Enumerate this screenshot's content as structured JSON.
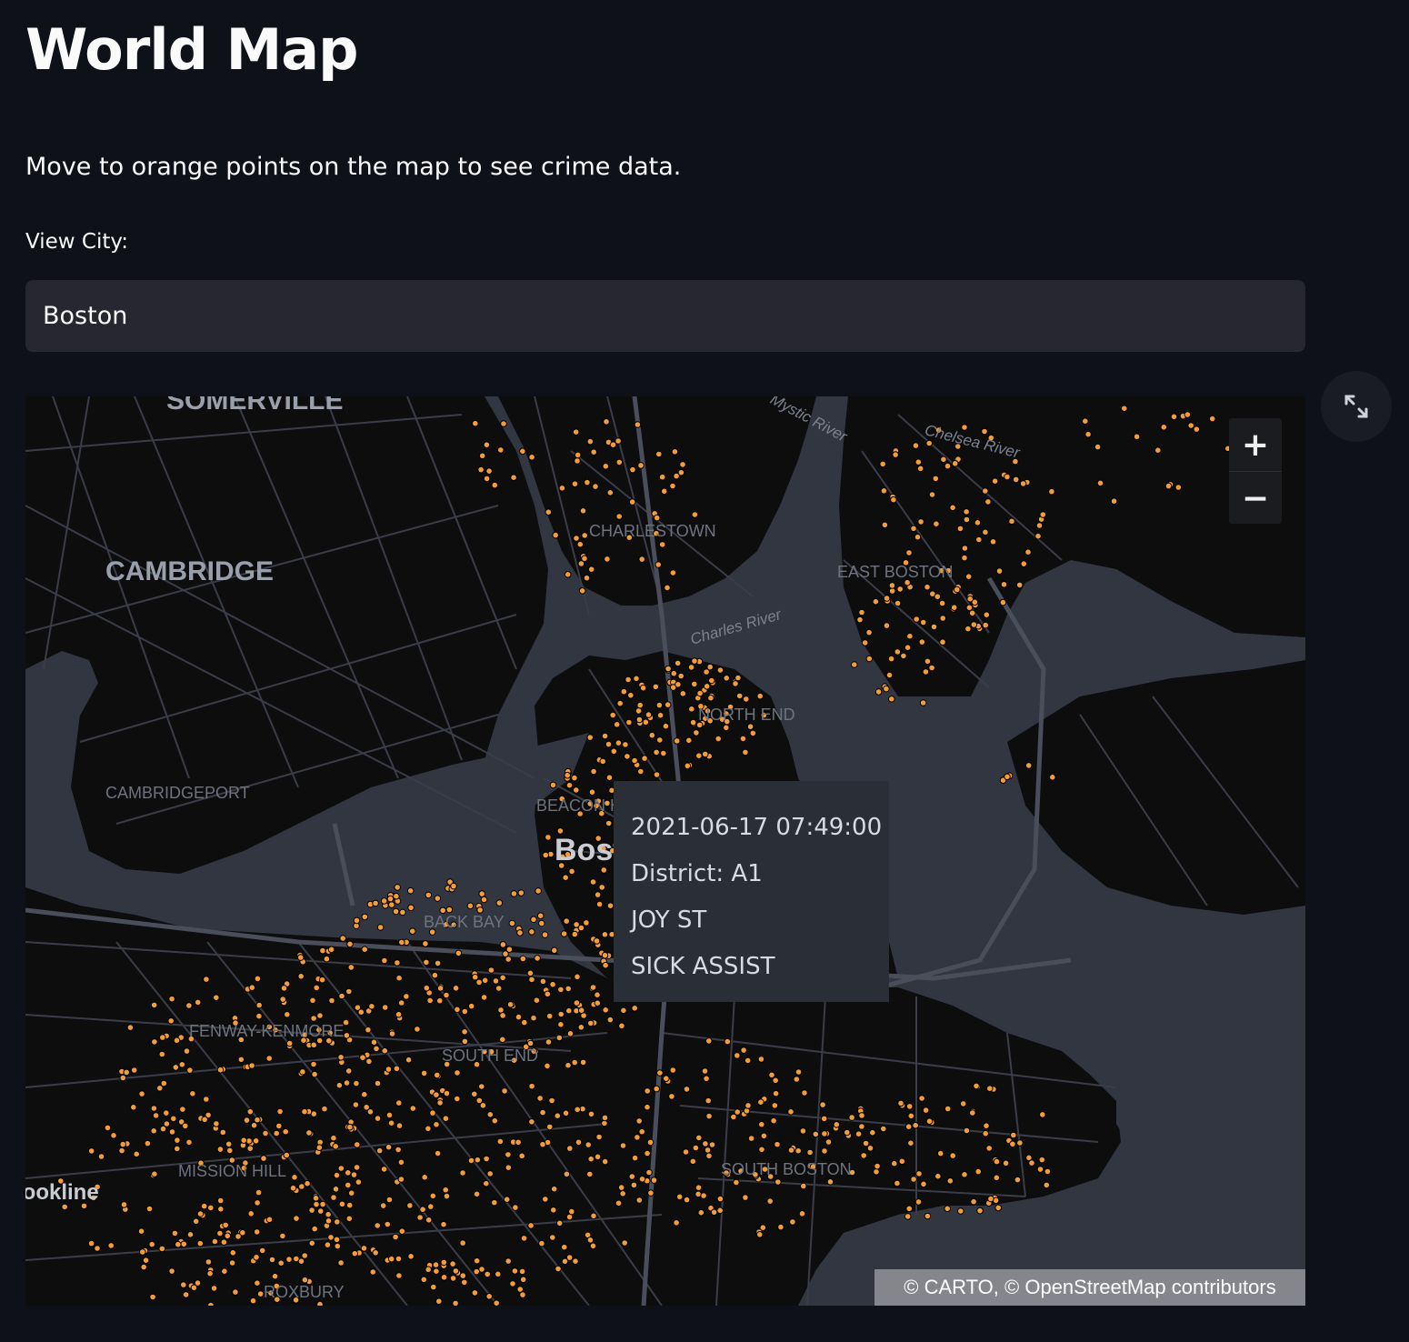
{
  "title": "World Map",
  "subtitle": "Move to orange points on the map to see crime data.",
  "city_select": {
    "label": "View City:",
    "value": "Boston"
  },
  "map": {
    "marker_color": "#f39c3a",
    "water_color": "#323640",
    "land_color": "#0d0d0e",
    "road_color": "#3a3d48",
    "icons": [
      "fullscreen-icon",
      "plus-icon",
      "minus-icon"
    ],
    "zoom_in_label": "+",
    "zoom_out_label": "−",
    "places": {
      "somerville": "SOMERVILLE",
      "cambridge": "CAMBRIDGE",
      "cambridgeport": "CAMBRIDGEPORT",
      "charlestown": "CHARLESTOWN",
      "east_boston": "EAST BOSTON",
      "north_end": "NORTH END",
      "beacon_hill": "BEACON HILL",
      "back_bay": "BACK BAY",
      "fenway_kenmore": "FENWAY-KENMORE",
      "south_end": "SOUTH END",
      "mission_hill": "MISSION HILL",
      "south_boston": "SOUTH BOSTON",
      "roxbury": "ROXBURY",
      "brookline": "Brookline",
      "boston": "Boston"
    },
    "water": {
      "mystic_river": "Mystic River",
      "chelsea_river": "Chelsea River",
      "charles_river": "Charles River"
    },
    "tooltip": {
      "datetime": "2021-06-17 07:49:00",
      "district": "District: A1",
      "street": "JOY ST",
      "offense": "SICK ASSIST"
    },
    "attribution": "© CARTO, © OpenStreetMap contributors"
  }
}
